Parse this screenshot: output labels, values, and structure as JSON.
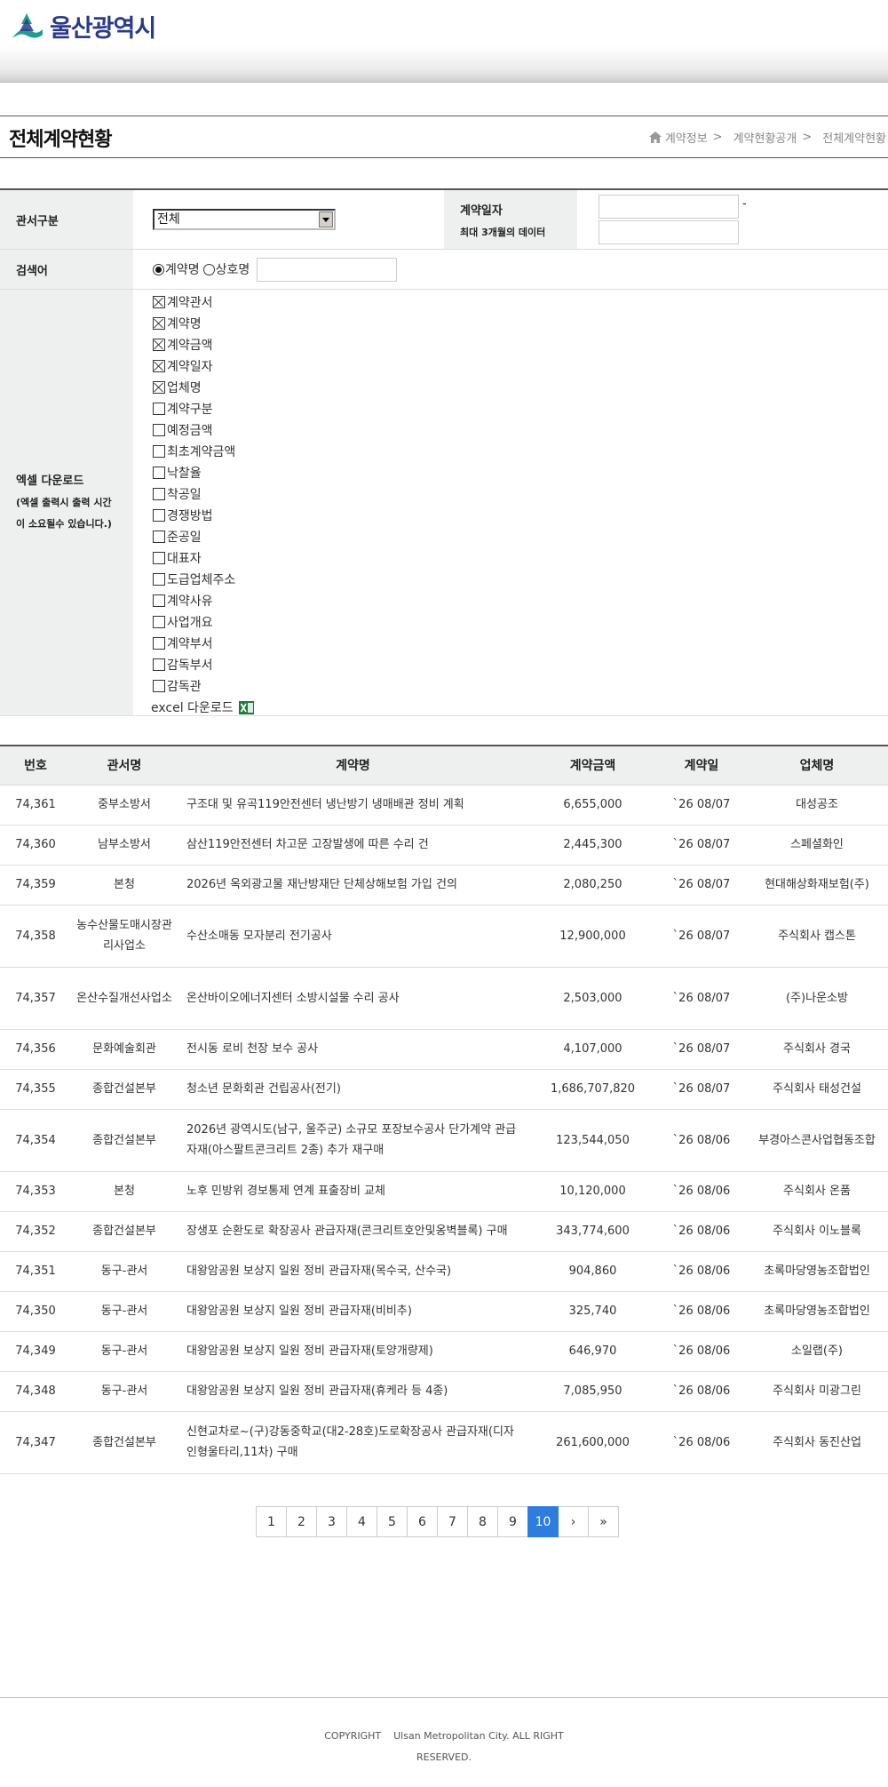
{
  "header": {
    "logo_text": "울산광역시"
  },
  "page": {
    "title": "전체계약현황",
    "breadcrumb": [
      "계약정보",
      "계약현황공개",
      "전체계약현황"
    ],
    "breadcrumb_sep": ">"
  },
  "search": {
    "dept_label": "관서구분",
    "dept_selected": "전체",
    "date_label": "계약일자",
    "date_note": "최대 3개월의 데이터",
    "date_dash": "-",
    "keyword_label": "검색어",
    "radio_options": [
      {
        "label": "계약명",
        "checked": true
      },
      {
        "label": "상호명",
        "checked": false
      }
    ],
    "excel_label": "엑셀 다운로드",
    "excel_note_1": "(엑셀 출력시 출력 시간",
    "excel_note_2": "이 소요될수 있습니다.)",
    "columns": [
      {
        "label": "계약관서",
        "checked": true
      },
      {
        "label": "계약명",
        "checked": true
      },
      {
        "label": "계약금액",
        "checked": true
      },
      {
        "label": "계약일자",
        "checked": true
      },
      {
        "label": "업체명",
        "checked": true
      },
      {
        "label": "계약구분",
        "checked": false
      },
      {
        "label": "예정금액",
        "checked": false
      },
      {
        "label": "최초계약금액",
        "checked": false
      },
      {
        "label": "낙찰율",
        "checked": false
      },
      {
        "label": "착공일",
        "checked": false
      },
      {
        "label": "경쟁방법",
        "checked": false
      },
      {
        "label": "준공일",
        "checked": false
      },
      {
        "label": "대표자",
        "checked": false
      },
      {
        "label": "도급업체주소",
        "checked": false
      },
      {
        "label": "계약사유",
        "checked": false
      },
      {
        "label": "사업개요",
        "checked": false
      },
      {
        "label": "계약부서",
        "checked": false
      },
      {
        "label": "감독부서",
        "checked": false
      },
      {
        "label": "감독관",
        "checked": false
      }
    ],
    "excel_download_label": "excel 다운로드",
    "excel_icon": "excel-icon"
  },
  "table": {
    "headers": [
      "번호",
      "관서명",
      "계약명",
      "계약금액",
      "계약일",
      "업체명"
    ],
    "rows": [
      [
        "74,361",
        "중부소방서",
        "구조대 및 유곡119안전센터 냉난방기 냉매배관 정비 계획",
        "6,655,000",
        "`26 08/07",
        "대성공조"
      ],
      [
        "74,360",
        "남부소방서",
        "삼산119안전센터 차고문 고장발생에 따른 수리 건",
        "2,445,300",
        "`26 08/07",
        "스페셜화인"
      ],
      [
        "74,359",
        "본청",
        "2026년 옥외광고물 재난방재단 단체상해보험 가입 건의",
        "2,080,250",
        "`26 08/07",
        "현대해상화재보험(주)"
      ],
      [
        "74,358",
        "농수산물도매시장관리사업소",
        "수산소매동 모자분리 전기공사",
        "12,900,000",
        "`26 08/07",
        "주식회사 캡스톤"
      ],
      [
        "74,357",
        "온산수질개선사업소",
        "온산바이오에너지센터 소방시설물 수리 공사",
        "2,503,000",
        "`26 08/07",
        "(주)나운소방"
      ],
      [
        "74,356",
        "문화예술회관",
        "전시동 로비 천장 보수 공사",
        "4,107,000",
        "`26 08/07",
        "주식회사 경국"
      ],
      [
        "74,355",
        "종합건설본부",
        "청소년 문화회관 건립공사(전기)",
        "1,686,707,820",
        "`26 08/07",
        "주식회사 태성건설"
      ],
      [
        "74,354",
        "종합건설본부",
        "2026년 광역시도(남구, 울주군) 소규모 포장보수공사 단가계약 관급자재(아스팔트콘크리트 2종) 추가 재구매",
        "123,544,050",
        "`26 08/06",
        "부경아스콘사업협동조합"
      ],
      [
        "74,353",
        "본청",
        "노후 민방위 경보통제 연계 표출장비 교체",
        "10,120,000",
        "`26 08/06",
        "주식회사 온품"
      ],
      [
        "74,352",
        "종합건설본부",
        "장생포 순환도로 확장공사 관급자재(콘크리트호안및옹벽블록) 구매",
        "343,774,600",
        "`26 08/06",
        "주식회사 이노블록"
      ],
      [
        "74,351",
        "동구-관서",
        "대왕암공원 보상지 일원 정비 관급자재(목수국, 산수국)",
        "904,860",
        "`26 08/06",
        "초록마당영농조합법인"
      ],
      [
        "74,350",
        "동구-관서",
        "대왕암공원 보상지 일원 정비 관급자재(비비추)",
        "325,740",
        "`26 08/06",
        "초록마당영농조합법인"
      ],
      [
        "74,349",
        "동구-관서",
        "대왕암공원 보상지 일원 정비 관급자재(토양개량제)",
        "646,970",
        "`26 08/06",
        "소일랩(주)"
      ],
      [
        "74,348",
        "동구-관서",
        "대왕암공원 보상지 일원 정비 관급자재(휴케라 등 4종)",
        "7,085,950",
        "`26 08/06",
        "주식회사 미광그린"
      ],
      [
        "74,347",
        "종합건설본부",
        "신현교차로~(구)강동중학교(대2-28호)도로확장공사 관급자재(디자인형울타리,11차) 구매",
        "261,600,000",
        "`26 08/06",
        "주식회사 동진산업"
      ]
    ]
  },
  "pagination": {
    "pages": [
      "1",
      "2",
      "3",
      "4",
      "5",
      "6",
      "7",
      "8",
      "9",
      "10"
    ],
    "current": "10",
    "next": "›",
    "last": "»"
  },
  "footer": {
    "copyright": "COPYRIGHT",
    "org": "Ulsan Metropolitan City. ALL RIGHT",
    "reserved": "RESERVED."
  }
}
